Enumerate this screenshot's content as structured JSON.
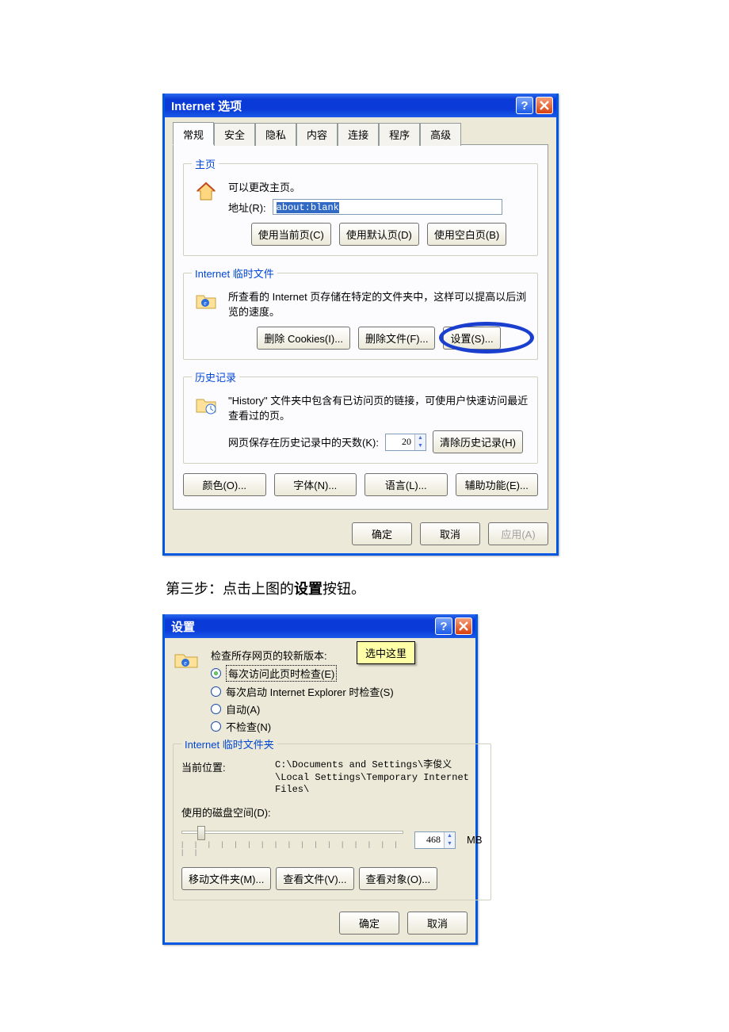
{
  "dialog1": {
    "title": "Internet 选项",
    "tabs": [
      "常规",
      "安全",
      "隐私",
      "内容",
      "连接",
      "程序",
      "高级"
    ],
    "homepage": {
      "legend": "主页",
      "desc": "可以更改主页。",
      "address_label": "地址(R):",
      "address_value": "about:blank",
      "btn_current": "使用当前页(C)",
      "btn_default": "使用默认页(D)",
      "btn_blank": "使用空白页(B)"
    },
    "tempfiles": {
      "legend": "Internet 临时文件",
      "desc": "所查看的 Internet 页存储在特定的文件夹中，这样可以提高以后浏览的速度。",
      "btn_cookies": "删除 Cookies(I)...",
      "btn_delete": "删除文件(F)...",
      "btn_settings": "设置(S)..."
    },
    "history": {
      "legend": "历史记录",
      "desc": "\"History\" 文件夹中包含有已访问页的链接，可使用户快速访问最近查看过的页。",
      "days_label": "网页保存在历史记录中的天数(K):",
      "days_value": "20",
      "btn_clear": "清除历史记录(H)"
    },
    "bottom_buttons": {
      "colors": "颜色(O)...",
      "fonts": "字体(N)...",
      "languages": "语言(L)...",
      "accessibility": "辅助功能(E)..."
    },
    "footer": {
      "ok": "确定",
      "cancel": "取消",
      "apply": "应用(A)"
    }
  },
  "between_text_prefix": "第三步：点击上图的",
  "between_text_bold": "设置",
  "between_text_suffix": "按钮。",
  "dialog2": {
    "title": "设置",
    "check_header": "检查所存网页的较新版本:",
    "radios": {
      "r1": "每次访问此页时检查(E)",
      "r2": "每次启动 Internet Explorer 时检查(S)",
      "r3": "自动(A)",
      "r4": "不检查(N)"
    },
    "hint": "选中这里",
    "temp": {
      "legend": "Internet 临时文件夹",
      "loc_label": "当前位置:",
      "loc_value": "C:\\Documents and Settings\\李俊义\\Local Settings\\Temporary Internet Files\\",
      "disk_label": "使用的磁盘空间(D):",
      "disk_value": "468",
      "disk_unit": "MB",
      "btn_move": "移动文件夹(M)...",
      "btn_view_files": "查看文件(V)...",
      "btn_view_obj": "查看对象(O)..."
    },
    "footer": {
      "ok": "确定",
      "cancel": "取消"
    }
  }
}
